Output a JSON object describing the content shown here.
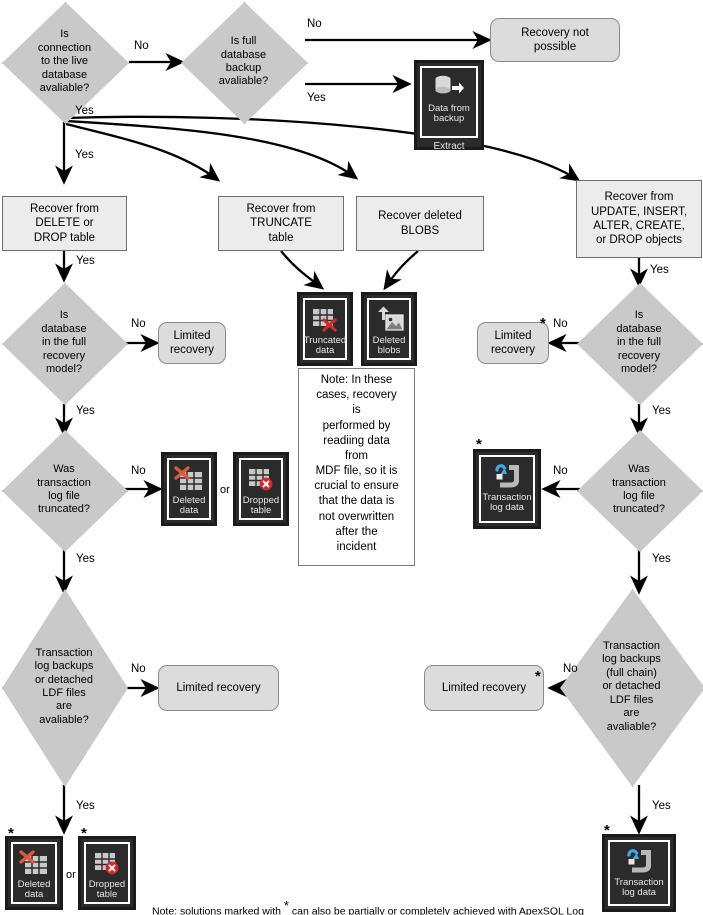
{
  "colors": {
    "diamond_fill": "#c9c9c9",
    "process_fill": "#ececec",
    "terminator_fill": "#dcdcdc",
    "icon_tile_bg": "#2b2b2b",
    "icon_caption": "#e8e8e8",
    "accent_red": "#d83b2e",
    "accent_blue": "#3da9e8",
    "line": "#000000",
    "page_bg": "#ffffff"
  },
  "decisions": {
    "d1_connection": "Is\nconnection\nto the live\ndatabase\navaliable?",
    "d2_full_backup": "Is full\ndatabase\nbackup\navaliable?",
    "d3_left_full_model": "Is\ndatabase\nin the full\nrecovery\nmodel?",
    "d4_left_log_truncated": "Was\ntransaction\nlog file\ntruncated?",
    "d5_left_log_backups": "Transaction\nlog backups\nor detached\nLDF files\nare\navaliable?",
    "d6_right_full_model": "Is\ndatabase\nin the full\nrecovery\nmodel?",
    "d7_right_log_truncated": "Was\ntransaction\nlog file\ntruncated?",
    "d8_right_log_backups": "Transaction\nlog backups\n(full chain)\nor detached\nLDF files\nare\navaliable?"
  },
  "processes": {
    "p_delete_drop": "Recover from\nDELETE or\nDROP table",
    "p_truncate": "Recover from\nTRUNCATE\ntable",
    "p_blobs": "Recover deleted\nBLOBS",
    "p_objects": "Recover from\nUPDATE, INSERT,\nALTER, CREATE,\nor DROP objects"
  },
  "terminators": {
    "t_recovery_not_possible": "Recovery not\npossible",
    "t_limited_left_1": "Limited\nrecovery",
    "t_limited_right_1": "Limited\nrecovery",
    "t_limited_left_2": "Limited recovery",
    "t_limited_right_2": "Limited recovery"
  },
  "icons": {
    "data_from_backup": {
      "caption": "Data from\nbackup",
      "footer": "Extract",
      "glyph": "database-export-icon"
    },
    "deleted_data_mid": {
      "caption": "Deleted\ndata",
      "glyph": "deleted-data-icon"
    },
    "dropped_table_mid": {
      "caption": "Dropped\ntable",
      "glyph": "dropped-table-icon"
    },
    "truncated_data": {
      "caption": "Truncated\ndata",
      "glyph": "truncated-data-icon"
    },
    "deleted_blobs": {
      "caption": "Deleted\nblobs",
      "glyph": "deleted-blobs-icon"
    },
    "transaction_log_mid": {
      "caption": "Transaction\nlog data",
      "glyph": "transaction-log-icon"
    },
    "deleted_data_bottom": {
      "caption": "Deleted\ndata",
      "glyph": "deleted-data-icon"
    },
    "dropped_table_bottom": {
      "caption": "Dropped\ntable",
      "glyph": "dropped-table-icon"
    },
    "transaction_log_bottom": {
      "caption": "Transaction\nlog data",
      "glyph": "transaction-log-icon"
    }
  },
  "labels": {
    "yes": "Yes",
    "no": "No",
    "or": "or",
    "star": "*"
  },
  "note_center": "Note: In these cases, recovery is\nperformed by\nreadiing data from\nMDF file, so it is crucial to ensure that the data is not overwritten after the incident",
  "note_center_lines": [
    "Note: In these",
    "cases, recovery",
    "is",
    "performed by",
    "readiing data",
    "from",
    "MDF file, so it is",
    "crucial to ensure",
    "that the data is",
    "not overwritten",
    "after the",
    "incident"
  ],
  "footer_note": {
    "prefix": "Note: solutions marked with",
    "star": "*",
    "suffix": "can also be partially or completely achieved with ApexSQL Log"
  }
}
